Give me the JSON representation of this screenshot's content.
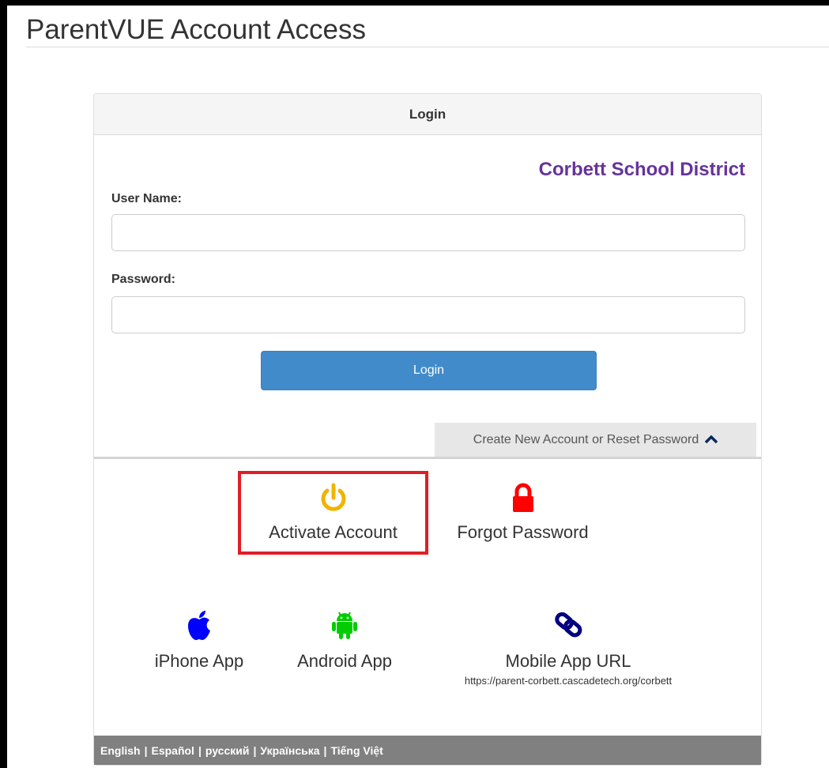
{
  "page": {
    "title": "ParentVUE Account Access"
  },
  "panel": {
    "header": "Login",
    "district": "Corbett School District",
    "username_label": "User Name:",
    "password_label": "Password:",
    "username_value": "",
    "password_value": "",
    "login_button": "Login",
    "create_tab": "Create New Account or Reset Password"
  },
  "actions": {
    "activate": {
      "label": "Activate Account",
      "icon": "power-icon",
      "color": "#f0b400"
    },
    "forgot": {
      "label": "Forgot Password",
      "icon": "lock-icon",
      "color": "#ff0000"
    }
  },
  "apps": {
    "iphone": {
      "label": "iPhone App",
      "icon": "apple-icon",
      "color": "#0000ff"
    },
    "android": {
      "label": "Android App",
      "icon": "android-icon",
      "color": "#00cc00"
    },
    "url": {
      "label": "Mobile App URL",
      "icon": "link-icon",
      "color": "#000080",
      "url": "https://parent-corbett.cascadetech.org/corbett"
    }
  },
  "footer": {
    "languages": [
      "English",
      "Español",
      "русский",
      "Українська",
      "Tiếng Việt"
    ]
  },
  "colors": {
    "district": "#663399",
    "login_button": "#428bca",
    "highlight_box": "#e21d26",
    "footer_bg": "#808080"
  }
}
